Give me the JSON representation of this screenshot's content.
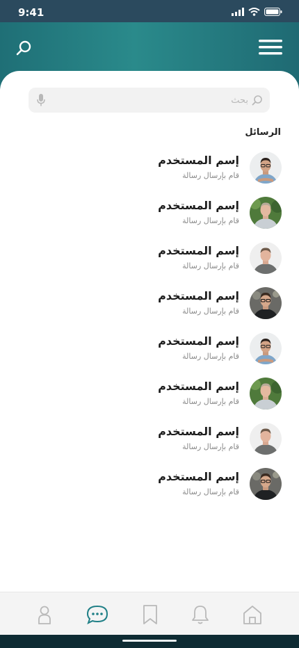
{
  "status_bar": {
    "time": "9:41"
  },
  "colors": {
    "accent": "#2a8a8b",
    "header_gradient_start": "#1f6f76",
    "status_bar_bg": "#2b4a5e",
    "active_tab": "#1f7f86",
    "inactive_tab": "#b9b9b9"
  },
  "header": {
    "search_icon": "search-icon",
    "menu_icon": "hamburger-menu-icon"
  },
  "search": {
    "placeholder": "بحث",
    "value": ""
  },
  "messages": {
    "title": "الرسائل",
    "items": [
      {
        "name": "إسم المستخدم",
        "subtitle": "قام بإرسال رسالة",
        "avatar": "man-glasses-crossed-arms"
      },
      {
        "name": "إسم المستخدم",
        "subtitle": "قام بإرسال رسالة",
        "avatar": "man-outdoors"
      },
      {
        "name": "إسم المستخدم",
        "subtitle": "قام بإرسال رسالة",
        "avatar": "man-grey-shirt"
      },
      {
        "name": "إسم المستخدم",
        "subtitle": "قام بإرسال رسالة",
        "avatar": "man-dark-glasses"
      },
      {
        "name": "إسم المستخدم",
        "subtitle": "قام بإرسال رسالة",
        "avatar": "man-glasses-crossed-arms"
      },
      {
        "name": "إسم المستخدم",
        "subtitle": "قام بإرسال رسالة",
        "avatar": "man-outdoors"
      },
      {
        "name": "إسم المستخدم",
        "subtitle": "قام بإرسال رسالة",
        "avatar": "man-grey-shirt"
      },
      {
        "name": "إسم المستخدم",
        "subtitle": "قام بإرسال رسالة",
        "avatar": "man-dark-glasses"
      }
    ]
  },
  "tabbar": {
    "tabs": [
      {
        "icon": "profile-icon",
        "active": false
      },
      {
        "icon": "chat-icon",
        "active": true
      },
      {
        "icon": "bookmark-icon",
        "active": false
      },
      {
        "icon": "bell-icon",
        "active": false
      },
      {
        "icon": "home-icon",
        "active": false
      }
    ]
  }
}
